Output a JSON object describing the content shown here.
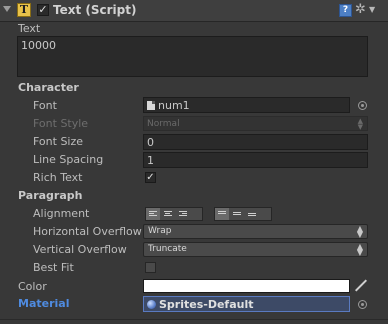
{
  "header": {
    "title": "Text (Script)",
    "icon": "T",
    "enabled": true
  },
  "text_section": {
    "label": "Text",
    "value": "10000"
  },
  "character": {
    "heading": "Character",
    "font": {
      "label": "Font",
      "value": "num1"
    },
    "font_style": {
      "label": "Font Style",
      "value": "Normal"
    },
    "font_size": {
      "label": "Font Size",
      "value": "0"
    },
    "line_spacing": {
      "label": "Line Spacing",
      "value": "1"
    },
    "rich_text": {
      "label": "Rich Text",
      "checked": true
    }
  },
  "paragraph": {
    "heading": "Paragraph",
    "alignment": {
      "label": "Alignment",
      "selected_h": "left",
      "selected_v": "top"
    },
    "horizontal_overflow": {
      "label": "Horizontal Overflow",
      "value": "Wrap"
    },
    "vertical_overflow": {
      "label": "Vertical Overflow",
      "value": "Truncate"
    },
    "best_fit": {
      "label": "Best Fit",
      "checked": false
    }
  },
  "color": {
    "label": "Color",
    "value": "#ffffff"
  },
  "material": {
    "label": "Material",
    "value": "Sprites-Default"
  },
  "icons": {
    "foldout": "foldout-triangle-icon",
    "component": "text-component-icon",
    "help": "help-icon",
    "settings": "gear-icon",
    "font_asset": "font-file-icon",
    "object_picker": "object-picker-icon",
    "dropdown": "dropdown-arrow-icon",
    "eyedropper": "eyedropper-icon",
    "material_sphere": "material-sphere-icon"
  }
}
